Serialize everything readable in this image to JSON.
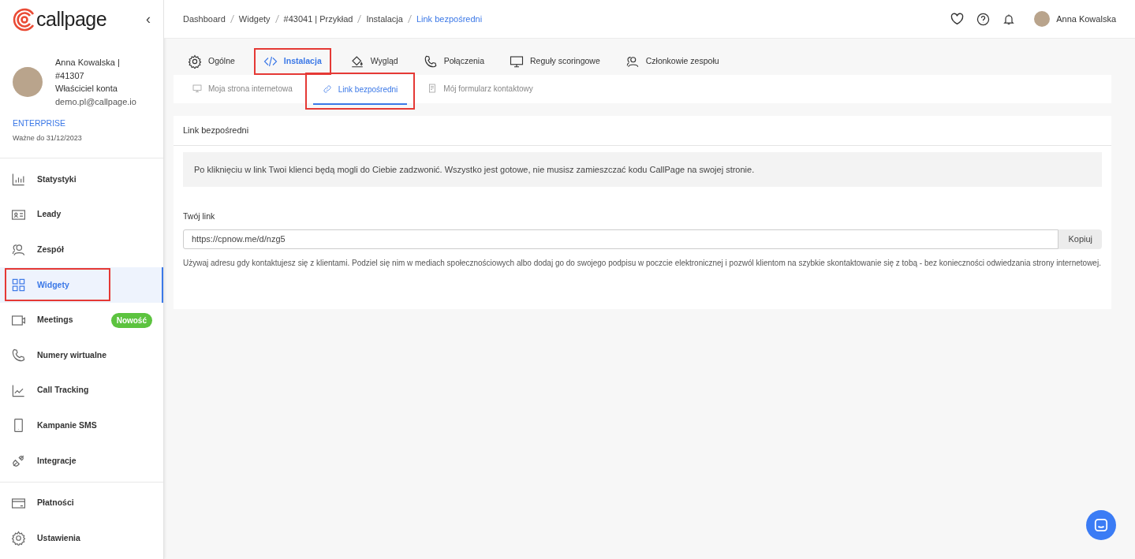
{
  "sidebar": {
    "logo": "callpage",
    "collapse": "‹",
    "user": {
      "name": "Anna Kowalska | #41307",
      "role": "Właściciel konta",
      "email": "demo.pl@callpage.io"
    },
    "plan": "ENTERPRISE",
    "valid": "Ważne do 31/12/2023",
    "groups": [
      [
        {
          "kind": "stats",
          "label": "Statystyki",
          "selected": false,
          "highlighted": false
        },
        {
          "kind": "leads",
          "label": "Leady",
          "selected": false,
          "highlighted": false
        },
        {
          "kind": "team",
          "label": "Zespół",
          "selected": false,
          "highlighted": false
        },
        {
          "kind": "widgets",
          "label": "Widgety",
          "selected": true,
          "highlighted": true
        },
        {
          "kind": "video",
          "label": "Meetings",
          "selected": false,
          "highlighted": false,
          "badge": "Nowość"
        },
        {
          "kind": "phone",
          "label": "Numery wirtualne",
          "selected": false,
          "highlighted": false
        },
        {
          "kind": "trend",
          "label": "Call Tracking",
          "selected": false,
          "highlighted": false
        },
        {
          "kind": "mobile",
          "label": "Kampanie SMS",
          "selected": false,
          "highlighted": false
        },
        {
          "kind": "plug",
          "label": "Integracje",
          "selected": false,
          "highlighted": false
        }
      ],
      [
        {
          "kind": "card",
          "label": "Płatności",
          "selected": false,
          "highlighted": false
        },
        {
          "kind": "gear",
          "label": "Ustawienia",
          "selected": false,
          "highlighted": false
        }
      ]
    ]
  },
  "breadcrumb": [
    "Dashboard",
    "Widgety",
    "#43041 | Przykład",
    "Instalacja",
    "Link bezpośredni"
  ],
  "topbar": {
    "user": "Anna Kowalska"
  },
  "tabs": [
    {
      "kind": "gear",
      "label": "Ogólne",
      "selected": false,
      "highlighted": false
    },
    {
      "kind": "code",
      "label": "Instalacja",
      "selected": true,
      "highlighted": true
    },
    {
      "kind": "bucket",
      "label": "Wygląd",
      "selected": false,
      "highlighted": false
    },
    {
      "kind": "phone",
      "label": "Połączenia",
      "selected": false,
      "highlighted": false
    },
    {
      "kind": "monitor",
      "label": "Reguły scoringowe",
      "selected": false,
      "highlighted": false
    },
    {
      "kind": "team",
      "label": "Członkowie zespołu",
      "selected": false,
      "highlighted": false
    }
  ],
  "subtabs": [
    {
      "kind": "monitor",
      "label": "Moja strona internetowa",
      "selected": false,
      "highlighted": false
    },
    {
      "kind": "link",
      "label": "Link bezpośredni",
      "selected": true,
      "highlighted": true
    },
    {
      "kind": "form",
      "label": "Mój formularz kontaktowy",
      "selected": false,
      "highlighted": false
    }
  ],
  "panel": {
    "title": "Link bezpośredni",
    "info": "Po kliknięciu w link Twoi klienci będą mogli do Ciebie zadzwonić. Wszystko jest gotowe, nie musisz zamieszczać kodu CallPage na swojej stronie.",
    "field_label": "Twój link",
    "value": "https://cpnow.me/d/nzg5",
    "button": "Kopiuj",
    "help": "Używaj adresu gdy kontaktujesz się z klientami. Podziel się nim w mediach społecznościowych albo dodaj go do swojego podpisu w poczcie elektronicznej i pozwól klientom na szybkie skontaktowanie się z tobą - bez konieczności odwiedzania strony internetowej."
  }
}
